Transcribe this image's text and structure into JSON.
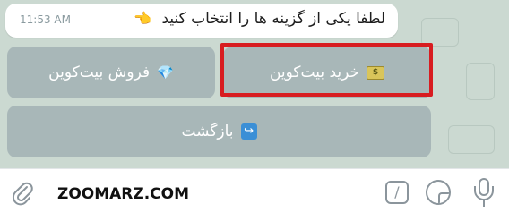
{
  "message": {
    "text": "لطفا یکی از گزینه ها را انتخاب کنید",
    "emoji": "👈",
    "time": "11:53 AM"
  },
  "keyboard": {
    "buy": {
      "label": "خرید بیت‌کوین",
      "icon": "dollar-banknote-icon",
      "icon_text": "$"
    },
    "sell": {
      "label": "فروش بیت‌کوین",
      "icon": "diamond-icon",
      "icon_text": "💎"
    },
    "back": {
      "label": "بازگشت",
      "icon": "return-arrow-icon",
      "icon_text": "↪"
    },
    "highlight_color": "#d81c20"
  },
  "input": {
    "text": "ZOOMARZ.COM"
  }
}
